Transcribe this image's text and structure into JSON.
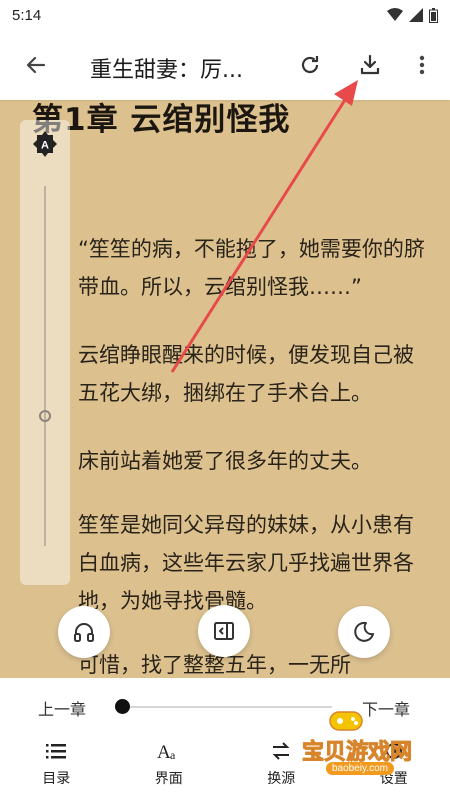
{
  "status_bar": {
    "time": "5:14"
  },
  "toolbar": {
    "title": "重生甜妻：厉..."
  },
  "content": {
    "chapter_title": "第1章 云绾别怪我",
    "paragraphs": [
      "“笙笙的病，不能拖了，她需要你的脐带血。所以，云绾别怪我……”",
      "云绾睁眼醒来的时候，便发现自己被五花大绑，捆绑在了手术台上。",
      "床前站着她爱了很多年的丈夫。",
      "笙笙是她同父异母的妹妹，从小患有白血病，这些年云家几乎找遍世界各地，为她寻找骨髓。",
      "可惜，找了整整五年，一无所"
    ]
  },
  "bottom": {
    "prev_chapter": "上一章",
    "next_chapter": "下一章",
    "progress": 0.0,
    "menu": [
      {
        "label": "目录",
        "icon": "toc-icon"
      },
      {
        "label": "界面",
        "icon": "font-icon"
      },
      {
        "label": "换源",
        "icon": "swap-source-icon"
      },
      {
        "label": "设置",
        "icon": "settings-icon"
      }
    ]
  },
  "watermark": {
    "text": "宝贝游戏网",
    "url": "baobeiy.com"
  },
  "colors": {
    "page_background": "#dcc18f",
    "annotation_arrow": "#e8494a",
    "watermark": "#e8b300"
  }
}
